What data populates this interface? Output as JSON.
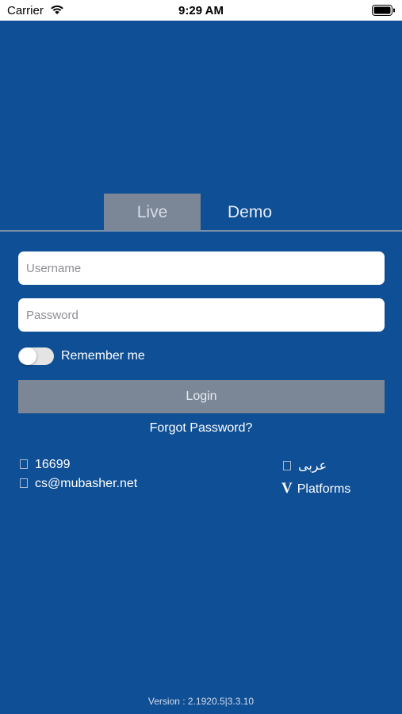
{
  "status_bar": {
    "carrier": "Carrier",
    "time": "9:29 AM",
    "wifi_icon": "wifi-icon",
    "battery_icon": "battery-icon"
  },
  "tabs": [
    {
      "label": "Live",
      "selected": true
    },
    {
      "label": "Demo",
      "selected": false
    }
  ],
  "form": {
    "username_placeholder": "Username",
    "username_value": "",
    "password_placeholder": "Password",
    "password_value": "",
    "remember_label": "Remember me",
    "remember_on": false,
    "login_label": "Login",
    "forgot_label": "Forgot Password?"
  },
  "contact": {
    "phone": "16699",
    "email": "cs@mubasher.net",
    "language": "عربى",
    "platforms_icon_text": "V",
    "platforms": "Platforms"
  },
  "version": "Version : 2.1920.5|3.3.10",
  "colors": {
    "background": "#0f4f95",
    "tab_selected": "#7b8796",
    "button_disabled": "#7b8796"
  }
}
